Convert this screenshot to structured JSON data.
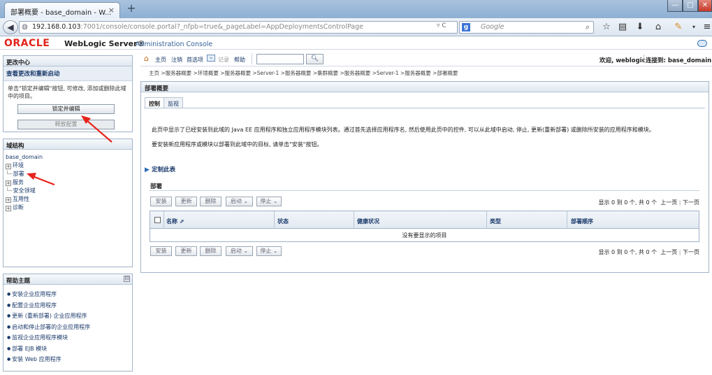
{
  "browser": {
    "tab_title": "部署概要 - base_domain - W...",
    "url_host": "192.168.0.103",
    "url_rest": ":7001/console/console.portal?_nfpb=true&_pageLabel=AppDeploymentsControlPage",
    "search_placeholder": "Google",
    "window_buttons": [
      "—",
      "□",
      "✕"
    ]
  },
  "header": {
    "oracle_logo": "ORACLE",
    "product": "WebLogic Server®",
    "console": "Administration Console"
  },
  "change_center": {
    "title": "更改中心",
    "subtitle": "查看更改和重新启动",
    "text": "单击\"锁定并编辑\"按钮, 可修改, 添加或删除此域中的项目。",
    "lock_button": "锁定并编辑",
    "release_button": "释放配置"
  },
  "domain_structure": {
    "title": "域结构",
    "root": "base_domain",
    "nodes": [
      {
        "label": "环境",
        "expandable": true
      },
      {
        "label": "部署",
        "expandable": false
      },
      {
        "label": "服务",
        "expandable": true
      },
      {
        "label": "安全领域",
        "expandable": false
      },
      {
        "label": "互用性",
        "expandable": true
      },
      {
        "label": "诊断",
        "expandable": true
      }
    ]
  },
  "help_topics": {
    "title": "帮助主题",
    "collapse_glyph": "⊟",
    "items": [
      "安装企业应用程序",
      "配置企业应用程序",
      "更新 (重新部署) 企业应用程序",
      "启动和停止部署的企业应用程序",
      "监视企业应用程序模块",
      "部署 EJB 模块",
      "安装 Web 应用程序"
    ]
  },
  "toolbar": {
    "home": "主页",
    "logout": "注销",
    "preferences": "首选项",
    "record": "记录",
    "help": "帮助",
    "welcome": "欢迎, weblogic",
    "connected": "连接到: base_domain"
  },
  "breadcrumb": "主页 >服务器概要 >环境概要 >服务器概要 >Server-1 >服务器概要 >集群概要 >服务器概要 >Server-1 >服务器概要 >部署概要",
  "main": {
    "title": "部署概要",
    "tabs": [
      "控制",
      "监视"
    ],
    "desc1": "此页中显示了已经安装到此域的 Java EE 应用程序和独立应用程序模块列表。通过首先选择应用程序名, 然后使用此页中的控件, 可以从此域中启动, 停止, 更新(重新部署) 或删除所安装的应用程序和模块。",
    "desc2": "要安装新应用程序或模块以部署到此域中的目标, 请单击\"安装\"按钮。",
    "customize": "定制此表",
    "deployments_title": "部署",
    "actions": [
      "安装",
      "更新",
      "删除",
      "启动 ⌄",
      "停止 ⌄"
    ],
    "pager_info": "显示 0 到 0 个, 共 0 个",
    "prev": "上一页",
    "next": "下一页",
    "columns": [
      "名称 ⇗",
      "状态",
      "健康状况",
      "类型",
      "部署顺序"
    ],
    "empty_text": "没有要显示的项目"
  },
  "annotation_color": "#e8231c"
}
